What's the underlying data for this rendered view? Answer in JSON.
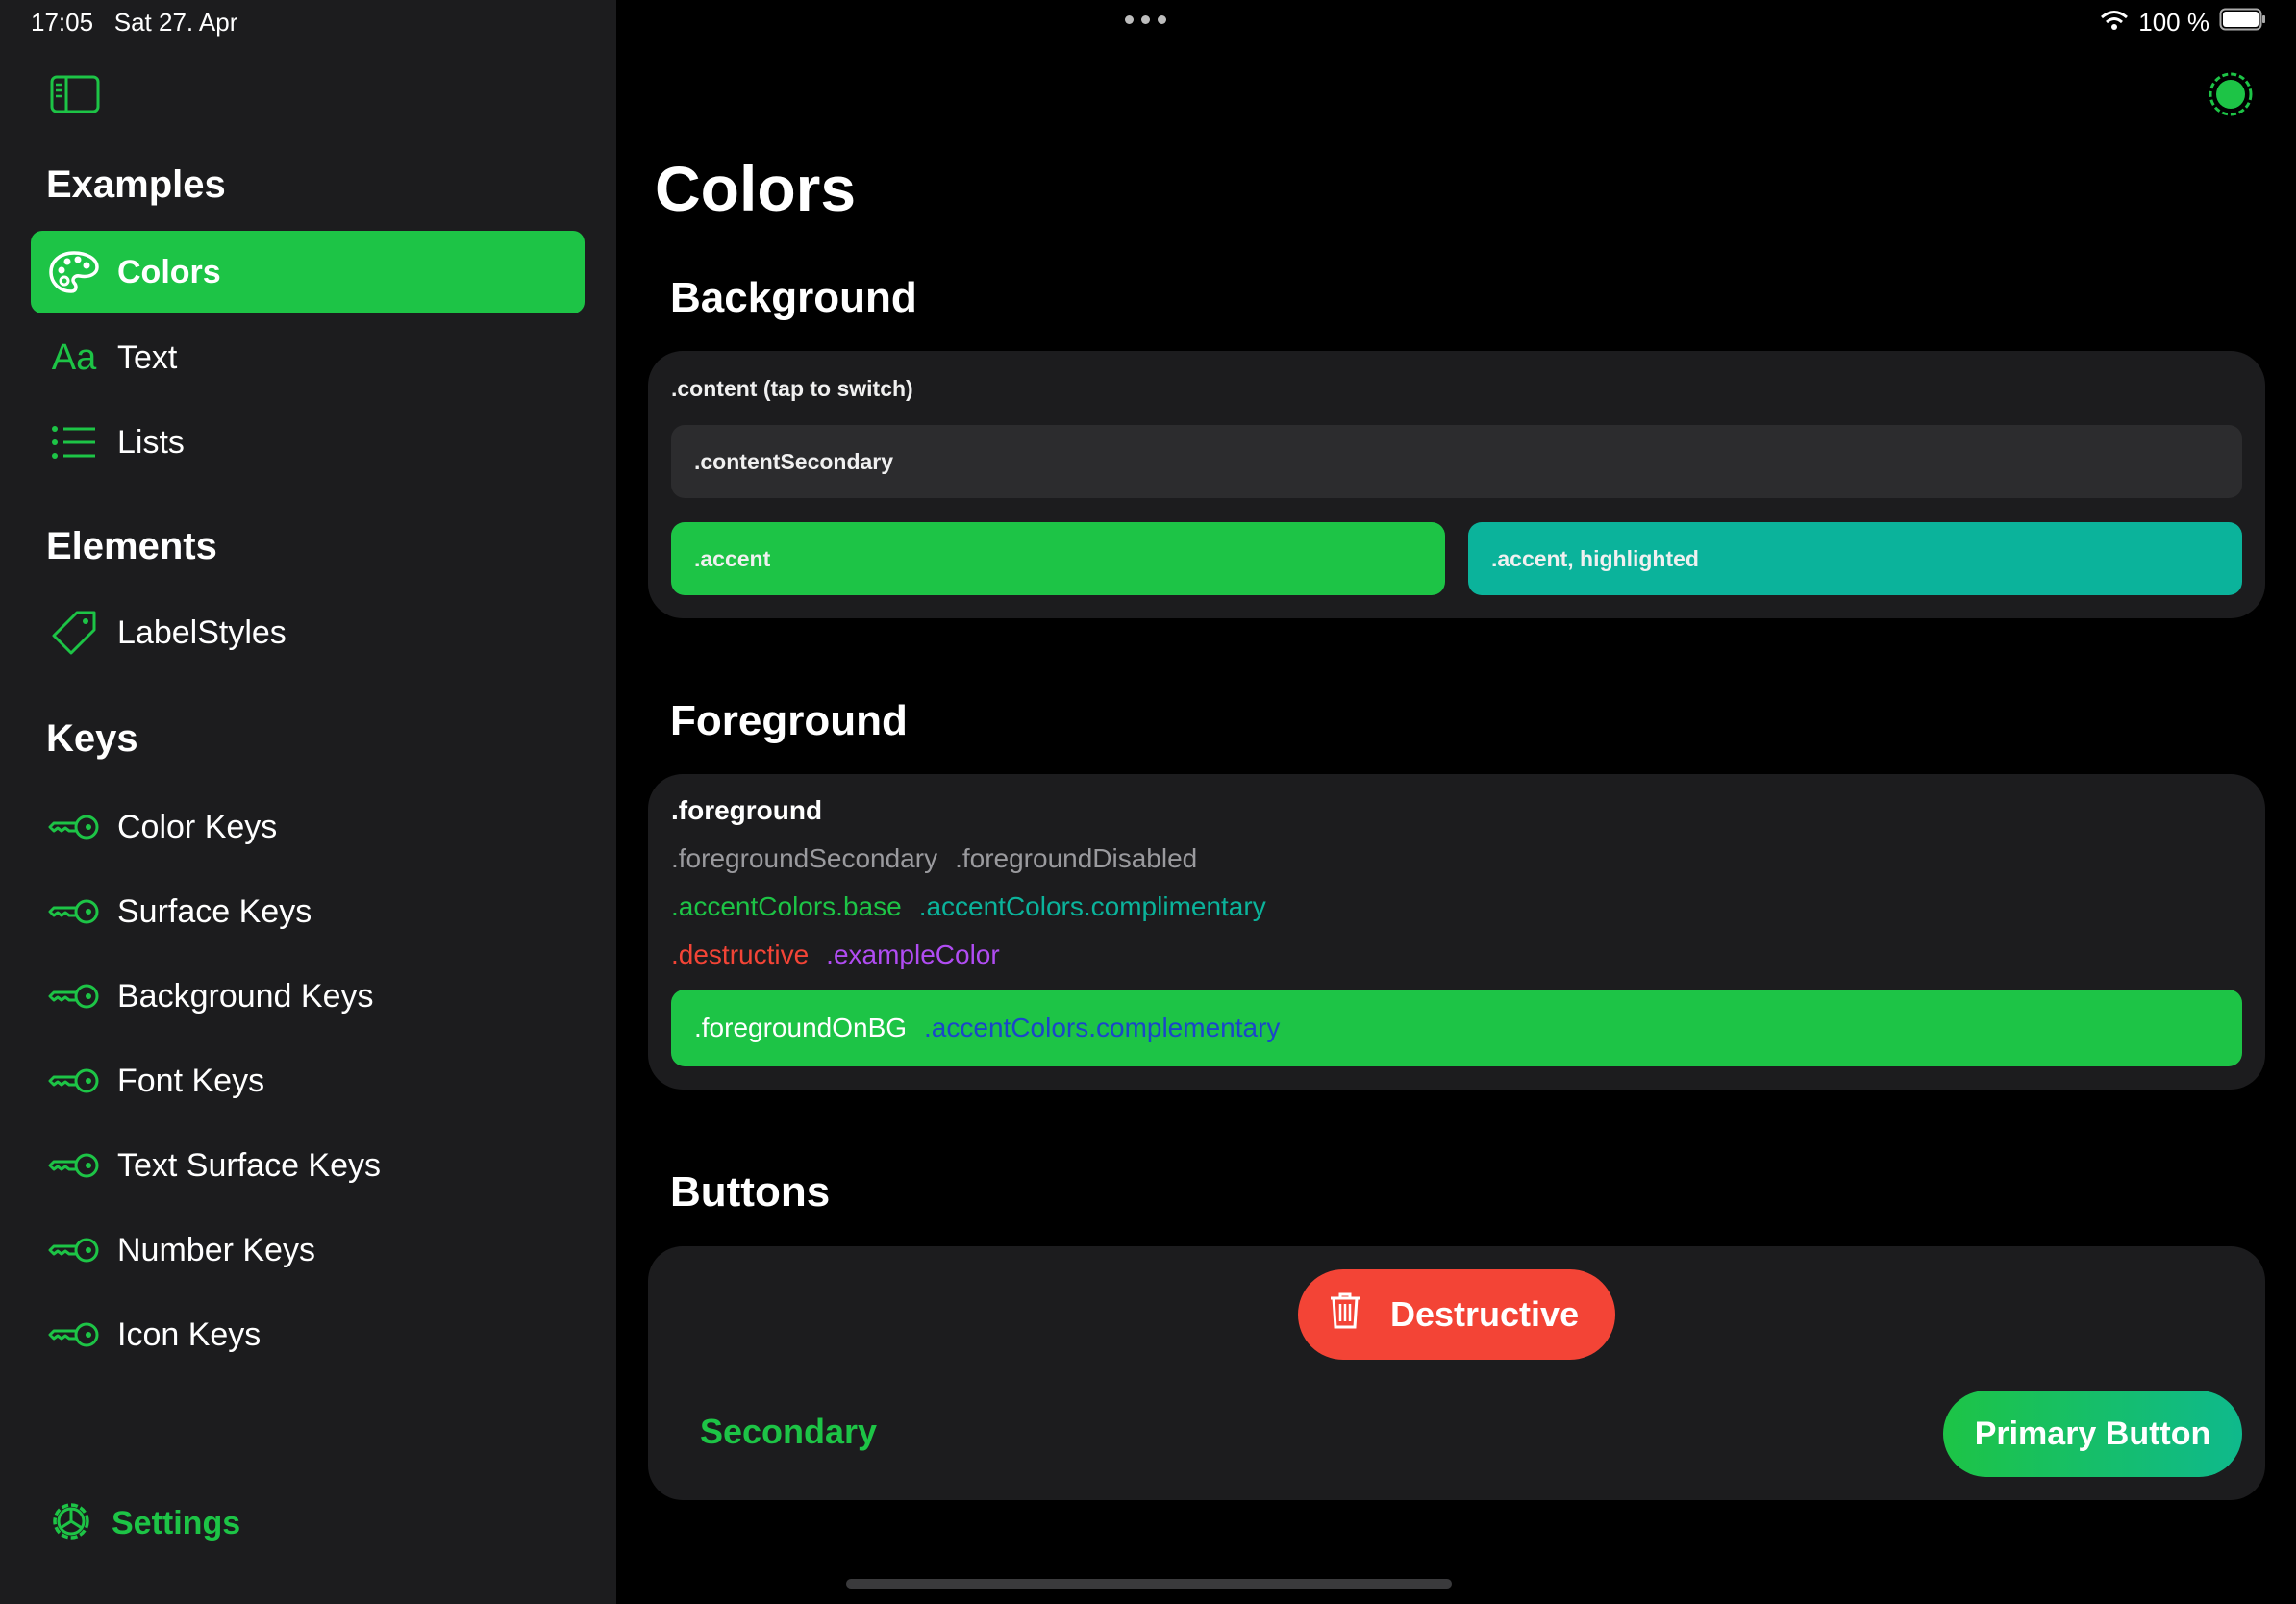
{
  "status_bar": {
    "time": "17:05",
    "date": "Sat 27. Apr",
    "battery": "100 %"
  },
  "colors": {
    "accent": "#1dc446",
    "accent_highlighted": "#0bb39b",
    "destructive": "#f34436",
    "example": "#b04cf2",
    "complementary_on_bg": "#1b46c9",
    "sidebar_bg": "#1c1c1e"
  },
  "sidebar": {
    "sections": [
      {
        "title": "Examples",
        "items": [
          {
            "label": "Colors",
            "icon": "palette-icon",
            "selected": true
          },
          {
            "label": "Text",
            "icon": "text-aa-icon"
          },
          {
            "label": "Lists",
            "icon": "list-bullet-icon"
          }
        ]
      },
      {
        "title": "Elements",
        "items": [
          {
            "label": "LabelStyles",
            "icon": "tag-icon"
          }
        ]
      },
      {
        "title": "Keys",
        "items": [
          {
            "label": "Color Keys",
            "icon": "key-icon"
          },
          {
            "label": "Surface Keys",
            "icon": "key-icon"
          },
          {
            "label": "Background Keys",
            "icon": "key-icon"
          },
          {
            "label": "Font Keys",
            "icon": "key-icon"
          },
          {
            "label": "Text Surface Keys",
            "icon": "key-icon"
          },
          {
            "label": "Number Keys",
            "icon": "key-icon"
          },
          {
            "label": "Icon Keys",
            "icon": "key-icon"
          }
        ]
      }
    ],
    "settings_label": "Settings"
  },
  "main": {
    "title": "Colors",
    "background": {
      "title": "Background",
      "content_label": ".content (tap to switch)",
      "content_secondary_label": ".contentSecondary",
      "accent_label": ".accent",
      "accent_highlighted_label": ".accent, highlighted"
    },
    "foreground": {
      "title": "Foreground",
      "foreground": ".foreground",
      "foreground_secondary": ".foregroundSecondary",
      "foreground_disabled": ".foregroundDisabled",
      "accent_base": ".accentColors.base",
      "accent_complimentary": ".accentColors.complimentary",
      "destructive": ".destructive",
      "example_color": ".exampleColor",
      "foreground_on_bg": ".foregroundOnBG",
      "accent_complementary": ".accentColors.complementary"
    },
    "buttons": {
      "title": "Buttons",
      "destructive": "Destructive",
      "secondary": "Secondary",
      "primary": "Primary Button"
    }
  }
}
